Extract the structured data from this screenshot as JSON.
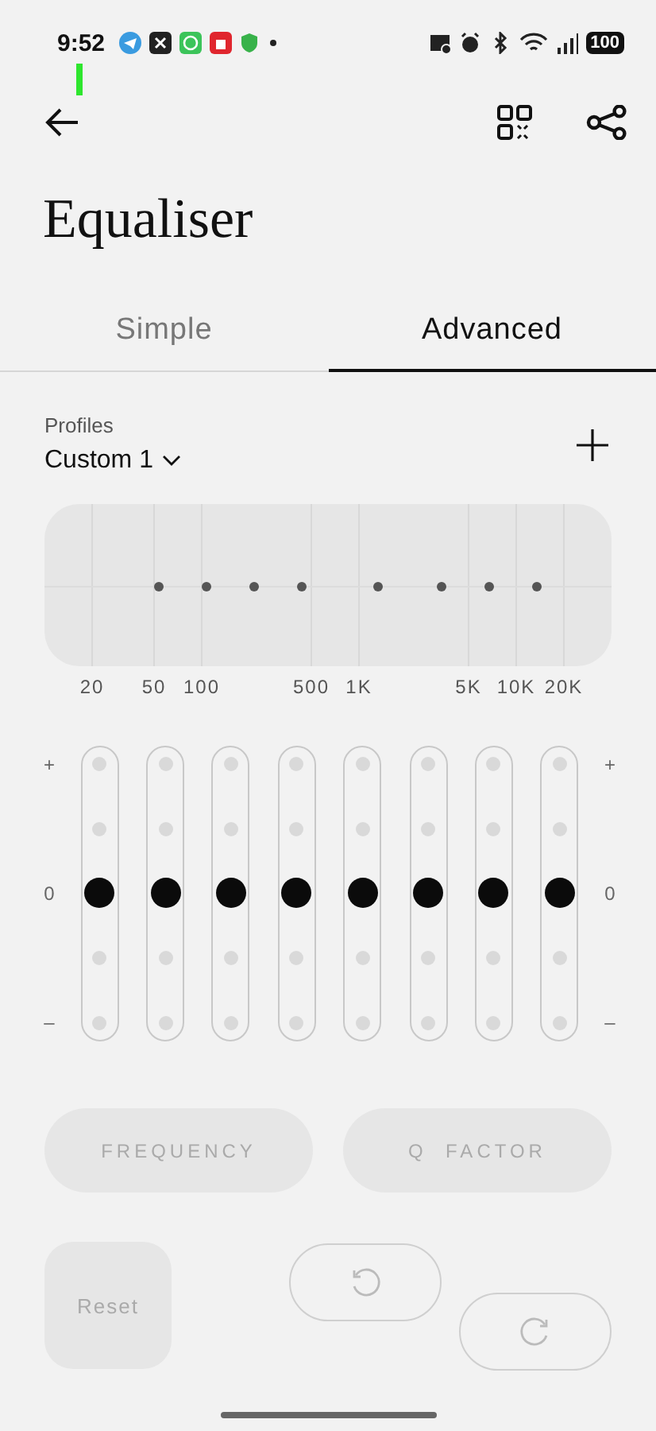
{
  "status_bar": {
    "time": "9:52",
    "battery": "100"
  },
  "title": "Equaliser",
  "tabs": [
    {
      "label": "Simple",
      "selected": false
    },
    {
      "label": "Advanced",
      "selected": true
    }
  ],
  "profiles": {
    "label": "Profiles",
    "current": "Custom 1"
  },
  "response_graph": {
    "frequency_labels": [
      "20",
      "50",
      "100",
      "500",
      "1K",
      "5K",
      "10K",
      "20K"
    ]
  },
  "scale_left": {
    "top": "+",
    "middle": "0",
    "bottom": "–"
  },
  "scale_right": {
    "top": "+",
    "middle": "0",
    "bottom": "–"
  },
  "bands": [
    {
      "level": 0.5
    },
    {
      "level": 0.5
    },
    {
      "level": 0.5
    },
    {
      "level": 0.5
    },
    {
      "level": 0.5
    },
    {
      "level": 0.5
    },
    {
      "level": 0.5
    },
    {
      "level": 0.5
    }
  ],
  "mode_buttons": [
    {
      "label": "FREQUENCY",
      "disabled": true
    },
    {
      "label": "Q  FACTOR",
      "disabled": true
    }
  ],
  "reset_button": {
    "label": "Reset",
    "disabled": true
  }
}
